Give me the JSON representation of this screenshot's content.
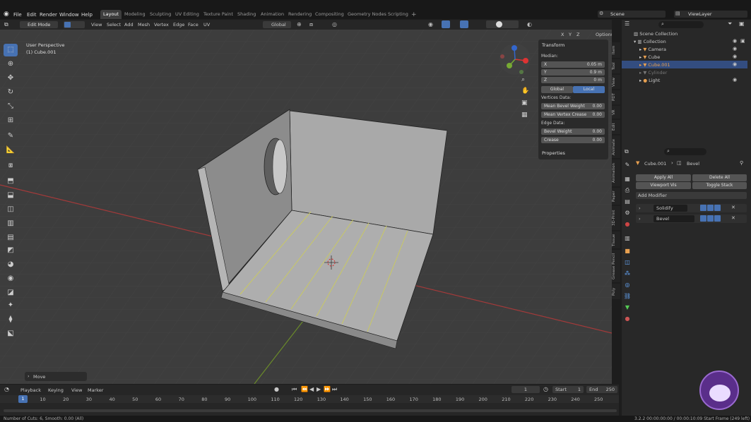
{
  "topbar": {
    "menus": [
      "File",
      "Edit",
      "Render",
      "Window",
      "Help"
    ],
    "workspaces": [
      "Layout",
      "Modeling",
      "Sculpting",
      "UV Editing",
      "Texture Paint",
      "Shading",
      "Animation",
      "Rendering",
      "Compositing",
      "Geometry Nodes",
      "Scripting"
    ],
    "active_workspace": "Layout",
    "add_tab": "+",
    "scene": "Scene",
    "view_layer": "ViewLayer"
  },
  "header": {
    "mode": "Edit Mode",
    "menus": [
      "View",
      "Select",
      "Add",
      "Mesh",
      "Vertex",
      "Edge",
      "Face",
      "UV"
    ],
    "transform_orientation": "Global",
    "options": "Options",
    "axes": [
      "X",
      "Y",
      "Z"
    ]
  },
  "viewport": {
    "perspective": "User Perspective",
    "object": "(1) Cube.001",
    "operator_panel": "Move",
    "gizmo_axes": [
      "X",
      "Y",
      "Z"
    ],
    "accent": "#4772b3",
    "floor_line_red": "#a23a3a",
    "floor_line_green": "#6a8a2a",
    "edge_highlight": "#c8c864"
  },
  "npanel": {
    "title": "Transform",
    "median": "Median:",
    "fields": [
      {
        "label": "X",
        "value": "0.05 m"
      },
      {
        "label": "Y",
        "value": "0.9 m"
      },
      {
        "label": "Z",
        "value": "0 m"
      }
    ],
    "global": "Global",
    "local": "Local",
    "vertices_data": "Vertices Data:",
    "mean_bevel_weight": {
      "label": "Mean Bevel Weight",
      "value": "0.00"
    },
    "mean_vertex_crease": {
      "label": "Mean Vertex Crease",
      "value": "0.00"
    },
    "edge_data": "Edge Data:",
    "bevel_weight": {
      "label": "Bevel Weight",
      "value": "0.00"
    },
    "crease": {
      "label": "Crease",
      "value": "0.00"
    },
    "properties": "Properties"
  },
  "sidetabs": [
    "Item",
    "Tool",
    "View",
    "PDT",
    "VR",
    "Edit",
    "Animate",
    "Animation",
    "Paper",
    "3D-Print",
    "Tissue",
    "Grease Pencil",
    "Poly"
  ],
  "outliner": {
    "root": "Scene Collection",
    "items": [
      {
        "name": "Collection",
        "color": "#cccccc"
      },
      {
        "name": "Camera",
        "color": "#cccccc"
      },
      {
        "name": "Cube",
        "color": "#cccccc"
      },
      {
        "name": "Cube.001",
        "color": "#e8a050"
      },
      {
        "name": "Cylinder",
        "color": "#777777"
      },
      {
        "name": "Light",
        "color": "#cccccc"
      }
    ]
  },
  "properties": {
    "breadcrumb_object": "Cube.001",
    "breadcrumb_modifier": "Bevel",
    "apply_all": "Apply All",
    "delete_all": "Delete All",
    "viewport_vis": "Viewport Vis",
    "toggle_stack": "Toggle Stack",
    "add_modifier": "Add Modifier",
    "modifiers": [
      "Solidify",
      "Bevel"
    ]
  },
  "timeline": {
    "menus": [
      "Playback",
      "Keying",
      "View",
      "Marker"
    ],
    "current_frame": "1",
    "start_label": "Start",
    "start": "1",
    "end_label": "End",
    "end": "250",
    "ticks": [
      "1",
      "10",
      "20",
      "30",
      "40",
      "50",
      "60",
      "70",
      "80",
      "90",
      "100",
      "110",
      "120",
      "130",
      "140",
      "150",
      "160",
      "170",
      "180",
      "190",
      "200",
      "210",
      "220",
      "230",
      "240",
      "250"
    ]
  },
  "status": {
    "left": "Number of Cuts: 6, Smooth: 0.00 (All)",
    "right": "3.2.2  00:00:00:00 / 00:00:10:09  Start Frame (249 left)"
  }
}
